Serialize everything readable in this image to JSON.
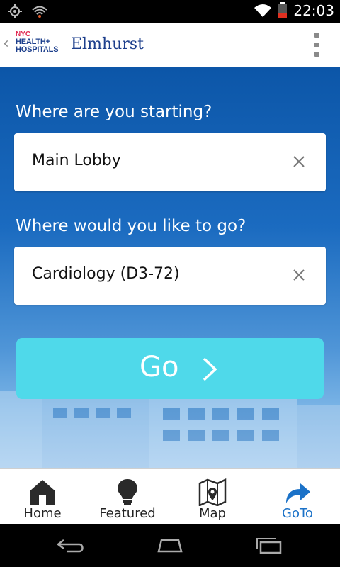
{
  "status_bar": {
    "time": "22:03"
  },
  "header": {
    "logo_lines": [
      "NYC",
      "HEALTH+",
      "HOSPITALS"
    ],
    "location_name": "Elmhurst"
  },
  "form": {
    "start_label": "Where are you starting?",
    "start_value": "Main Lobby",
    "dest_label": "Where would you like to go?",
    "dest_value": "Cardiology (D3-72)",
    "go_label": "Go"
  },
  "tabs": [
    {
      "label": "Home",
      "icon": "home-icon",
      "active": false
    },
    {
      "label": "Featured",
      "icon": "lightbulb-icon",
      "active": false
    },
    {
      "label": "Map",
      "icon": "map-icon",
      "active": false
    },
    {
      "label": "GoTo",
      "icon": "goto-arrow-icon",
      "active": true
    }
  ],
  "colors": {
    "accent": "#1b72c8",
    "go_button": "#4fd9ea",
    "brand_blue": "#1d3f8c",
    "brand_pink": "#e0254f"
  }
}
